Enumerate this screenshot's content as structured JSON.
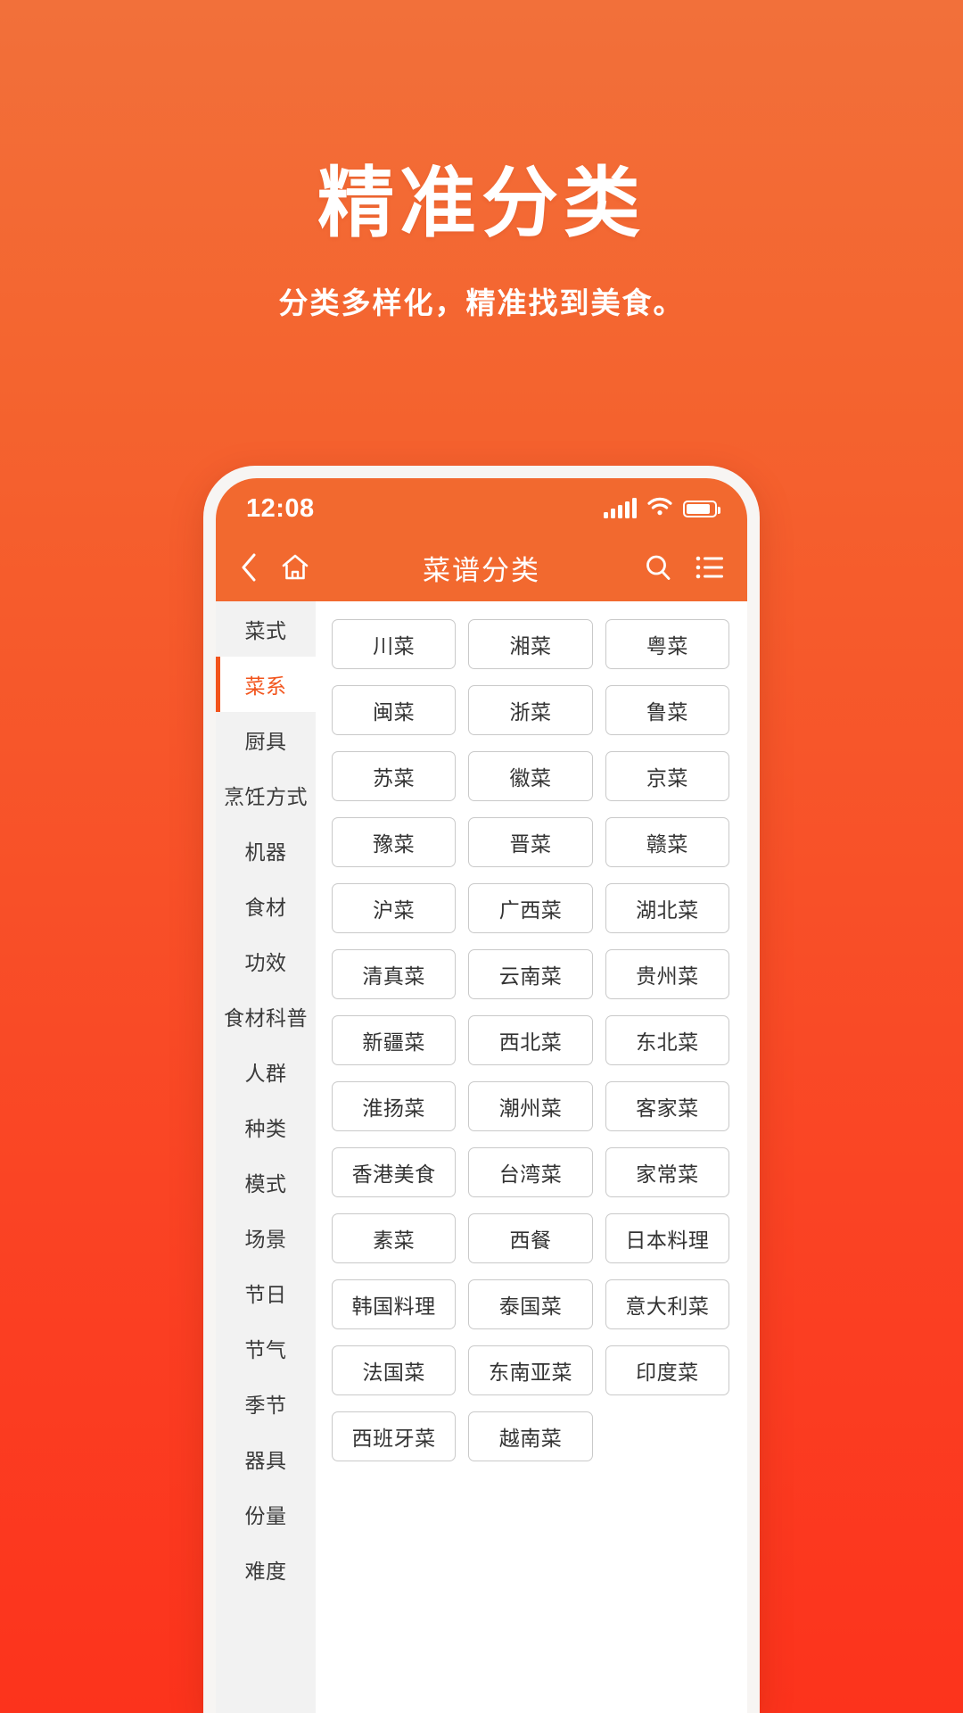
{
  "promo": {
    "title": "精准分类",
    "subtitle": "分类多样化，精准找到美食。"
  },
  "colors": {
    "bg_top": "#F2703A",
    "bg_bottom": "#FC331C",
    "accent": "#F2541C",
    "header_bar": "#F2692F",
    "chip_border": "#C9C9C9",
    "sidebar_bg": "#F2F2F2"
  },
  "status_bar": {
    "time": "12:08",
    "icons": [
      "signal-icon",
      "wifi-icon",
      "battery-icon"
    ]
  },
  "header": {
    "title": "菜谱分类",
    "back_icon": "chevron-left-icon",
    "home_icon": "home-icon",
    "search_icon": "search-icon",
    "menu_icon": "list-menu-icon"
  },
  "sidebar": {
    "active_index": 1,
    "items": [
      {
        "label": "菜式"
      },
      {
        "label": "菜系"
      },
      {
        "label": "厨具"
      },
      {
        "label": "烹饪方式"
      },
      {
        "label": "机器"
      },
      {
        "label": "食材"
      },
      {
        "label": "功效"
      },
      {
        "label": "食材科普"
      },
      {
        "label": "人群"
      },
      {
        "label": "种类"
      },
      {
        "label": "模式"
      },
      {
        "label": "场景"
      },
      {
        "label": "节日"
      },
      {
        "label": "节气"
      },
      {
        "label": "季节"
      },
      {
        "label": "器具"
      },
      {
        "label": "份量"
      },
      {
        "label": "难度"
      }
    ]
  },
  "grid": {
    "chips": [
      {
        "label": "川菜"
      },
      {
        "label": "湘菜"
      },
      {
        "label": "粤菜"
      },
      {
        "label": "闽菜"
      },
      {
        "label": "浙菜"
      },
      {
        "label": "鲁菜"
      },
      {
        "label": "苏菜"
      },
      {
        "label": "徽菜"
      },
      {
        "label": "京菜"
      },
      {
        "label": "豫菜"
      },
      {
        "label": "晋菜"
      },
      {
        "label": "赣菜"
      },
      {
        "label": "沪菜"
      },
      {
        "label": "广西菜"
      },
      {
        "label": "湖北菜"
      },
      {
        "label": "清真菜"
      },
      {
        "label": "云南菜"
      },
      {
        "label": "贵州菜"
      },
      {
        "label": "新疆菜"
      },
      {
        "label": "西北菜"
      },
      {
        "label": "东北菜"
      },
      {
        "label": "淮扬菜"
      },
      {
        "label": "潮州菜"
      },
      {
        "label": "客家菜"
      },
      {
        "label": "香港美食"
      },
      {
        "label": "台湾菜"
      },
      {
        "label": "家常菜"
      },
      {
        "label": "素菜"
      },
      {
        "label": "西餐"
      },
      {
        "label": "日本料理"
      },
      {
        "label": "韩国料理"
      },
      {
        "label": "泰国菜"
      },
      {
        "label": "意大利菜"
      },
      {
        "label": "法国菜"
      },
      {
        "label": "东南亚菜"
      },
      {
        "label": "印度菜"
      },
      {
        "label": "西班牙菜"
      },
      {
        "label": "越南菜"
      }
    ]
  }
}
